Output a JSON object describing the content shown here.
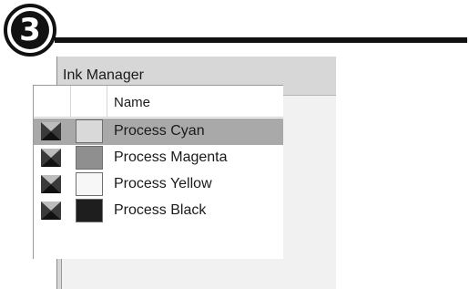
{
  "step": {
    "number": "3"
  },
  "window": {
    "title": "Ink Manager"
  },
  "ink_list": {
    "columns": {
      "name": "Name"
    },
    "rows": [
      {
        "name": "Process Cyan",
        "swatch_color": "#d9d9d9",
        "selected": true,
        "icon": "process-ink-icon"
      },
      {
        "name": "Process Magenta",
        "swatch_color": "#8f8f8f",
        "selected": false,
        "icon": "process-ink-icon"
      },
      {
        "name": "Process Yellow",
        "swatch_color": "#f7f7f7",
        "selected": false,
        "icon": "process-ink-icon"
      },
      {
        "name": "Process Black",
        "swatch_color": "#1e1e1e",
        "selected": false,
        "icon": "process-ink-icon"
      }
    ]
  },
  "colors": {
    "selection": "#a9a9a9",
    "rule": "#111111"
  }
}
